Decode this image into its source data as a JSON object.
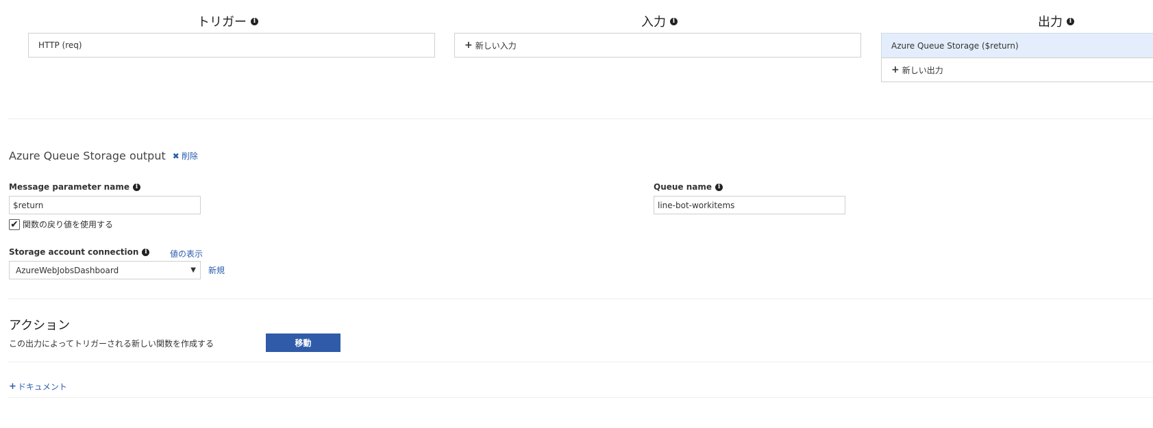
{
  "columns": {
    "trigger": {
      "title": "トリガー",
      "item": "HTTP (req)"
    },
    "input": {
      "title": "入力",
      "new_label": "新しい入力"
    },
    "output": {
      "title": "出力",
      "item": "Azure Queue Storage ($return)",
      "new_label": "新しい出力"
    }
  },
  "section": {
    "title": "Azure Queue Storage output",
    "delete_label": "削除"
  },
  "form": {
    "message_param": {
      "label": "Message parameter name",
      "value": "$return"
    },
    "use_return": {
      "label": "関数の戻り値を使用する",
      "checked": true
    },
    "queue_name": {
      "label": "Queue name",
      "value": "line-bot-workitems"
    },
    "storage_conn": {
      "label": "Storage account connection",
      "show_value": "値の表示",
      "selected": "AzureWebJobsDashboard",
      "new_label": "新規"
    }
  },
  "actions": {
    "title": "アクション",
    "description": "この出力によってトリガーされる新しい関数を作成する",
    "go_button": "移動"
  },
  "docs": {
    "label": "ドキュメント"
  },
  "icons": [
    "info-icon",
    "plus-icon",
    "close-icon",
    "check-icon",
    "caret-down-icon"
  ],
  "colors": {
    "accent": "#2f5ba8",
    "link": "#2b5cae",
    "selected_bg": "#e3edfb"
  }
}
